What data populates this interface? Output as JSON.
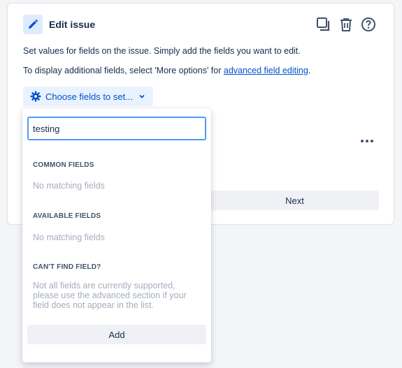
{
  "panel": {
    "title": "Edit issue",
    "description": "Set values for fields on the issue. Simply add the fields you want to edit.",
    "advanced_prefix": "To display additional fields, select 'More options' for ",
    "advanced_link": "advanced field editing",
    "advanced_suffix": ".",
    "choose_fields_label": "Choose fields to set...",
    "next_label": "Next",
    "icons": [
      "pencil-icon",
      "duplicate-icon",
      "trash-icon",
      "help-icon",
      "gear-icon",
      "chevron-down-icon",
      "more-icon"
    ]
  },
  "dropdown": {
    "search_value": "testing",
    "common_fields_heading": "COMMON FIELDS",
    "common_fields_empty": "No matching fields",
    "available_fields_heading": "AVAILABLE FIELDS",
    "available_fields_empty": "No matching fields",
    "cant_find_heading": "CAN'T FIND FIELD?",
    "cant_find_text": "Not all fields are currently supported, please use the advanced section if your field does not appear in the list.",
    "add_label": "Add"
  },
  "colors": {
    "accent": "#0052cc",
    "focus_border": "#4c9aff",
    "button_bg": "#f0f1f4",
    "muted_text": "#a5adba"
  }
}
